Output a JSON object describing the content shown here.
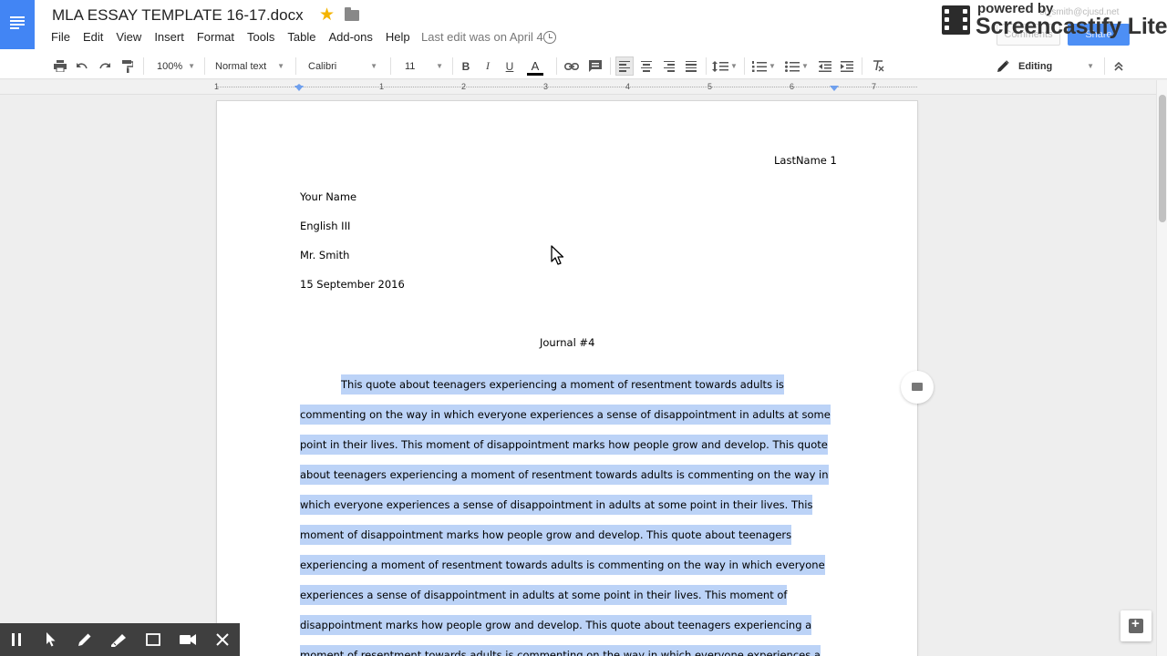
{
  "app": {
    "doc_title": "MLA ESSAY TEMPLATE 16-17.docx",
    "last_edit": "Last edit was on April 4",
    "menu": [
      "File",
      "Edit",
      "View",
      "Insert",
      "Format",
      "Tools",
      "Table",
      "Add-ons",
      "Help"
    ],
    "account_email": "el_smith@cjusd.net",
    "comments_label": "Comments",
    "share_label": "Share"
  },
  "overlay": {
    "powered_by": "powered by",
    "brand": "Screencastify Lite"
  },
  "toolbar": {
    "zoom": "100%",
    "style": "Normal text",
    "font": "Calibri",
    "font_size": "11",
    "bold": "B",
    "italic": "I",
    "underline": "U",
    "text_color_letter": "A",
    "text_color": "#000000",
    "mode": "Editing"
  },
  "ruler": {
    "numbers": [
      "1",
      "1",
      "2",
      "3",
      "4",
      "5",
      "6",
      "7"
    ]
  },
  "document": {
    "header_right": "LastName 1",
    "heading_lines": [
      "Your Name",
      "English III",
      "Mr. Smith",
      "15 September 2016"
    ],
    "title": "Journal #4",
    "selection_color": "#bcd3f7",
    "body_lines": [
      "This quote about teenagers experiencing a moment of resentment towards adults is",
      "commenting on the way in which everyone experiences a sense of disappointment in adults at some",
      "point in their lives. This moment of disappointment marks how people grow and develop. This quote",
      "about teenagers experiencing a moment of resentment towards adults is commenting on the way in",
      "which everyone experiences a sense of disappointment in adults at some point in their lives. This",
      "moment of disappointment marks how people grow and develop. This quote about teenagers",
      "experiencing a moment of resentment towards adults is commenting on the way in which everyone",
      "experiences a sense of disappointment in adults at some point in their lives. This moment of",
      "disappointment marks how people grow and develop. This quote about teenagers experiencing a",
      "moment of resentment towards adults is commenting on the way in which everyone experiences a"
    ]
  },
  "colors": {
    "brand_blue": "#4285f4",
    "star": "#f4b400",
    "record_bar": "#3f3f3f"
  },
  "icons": [
    "docs-logo-icon",
    "star-icon",
    "folder-icon",
    "history-icon",
    "print-icon",
    "undo-icon",
    "redo-icon",
    "paint-format-icon",
    "link-icon",
    "comment-icon",
    "align-left-icon",
    "align-center-icon",
    "align-right-icon",
    "align-justify-icon",
    "line-spacing-icon",
    "numbered-list-icon",
    "bulleted-list-icon",
    "decrease-indent-icon",
    "increase-indent-icon",
    "clear-formatting-icon",
    "pencil-icon",
    "collapse-icon",
    "add-comment-icon",
    "explore-icon",
    "pause-icon",
    "pointer-icon",
    "pen-icon",
    "highlighter-icon",
    "rectangle-icon",
    "camera-icon",
    "close-icon"
  ]
}
